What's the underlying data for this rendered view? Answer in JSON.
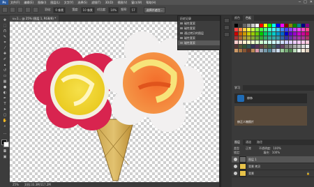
{
  "app": {
    "logo": "Ps"
  },
  "menu": [
    "文件(F)",
    "编辑(E)",
    "图像(I)",
    "图层(L)",
    "文字(Y)",
    "选择(S)",
    "滤镜(T)",
    "3D(D)",
    "视图(V)",
    "窗口(W)",
    "帮助(H)"
  ],
  "window_controls": [
    "─",
    "□",
    "✕"
  ],
  "options": {
    "feather_label": "羽化:",
    "feather_value": "0 像素",
    "width_label": "宽度:",
    "width_value": "10 像素",
    "contrast_label": "对比度:",
    "contrast_value": "10%",
    "freq_label": "频率:",
    "freq_value": "57",
    "refine_button": "选择并遮住..."
  },
  "document_tab": "u=1... @ 25% (图层 1, RGB/8) *",
  "status": {
    "zoom": "25%",
    "doc": "文档:33.3M/117.2M"
  },
  "history": {
    "title": "历史记录",
    "items": [
      "磁性套索",
      "磁性套索",
      "通过拷贝的图层",
      "磁性套索",
      "磁性套索"
    ],
    "selected_index": 4
  },
  "right_tabs": [
    "颜色",
    "色板"
  ],
  "learn": {
    "tab": "学习",
    "card1": "修饰",
    "card2": "修正人物照片"
  },
  "layers": {
    "tabs": [
      "图层",
      "通道",
      "路径"
    ],
    "kind_label": "类型",
    "blend_mode": "正常",
    "opacity_label": "不透明度:",
    "opacity_value": "100%",
    "lock_label": "锁定:",
    "fill_label": "填充:",
    "fill_value": "100%",
    "rows": [
      {
        "name": "图层 1",
        "selected": true
      },
      {
        "name": "背景 拷贝",
        "selected": false
      },
      {
        "name": "背景",
        "selected": false
      }
    ]
  }
}
